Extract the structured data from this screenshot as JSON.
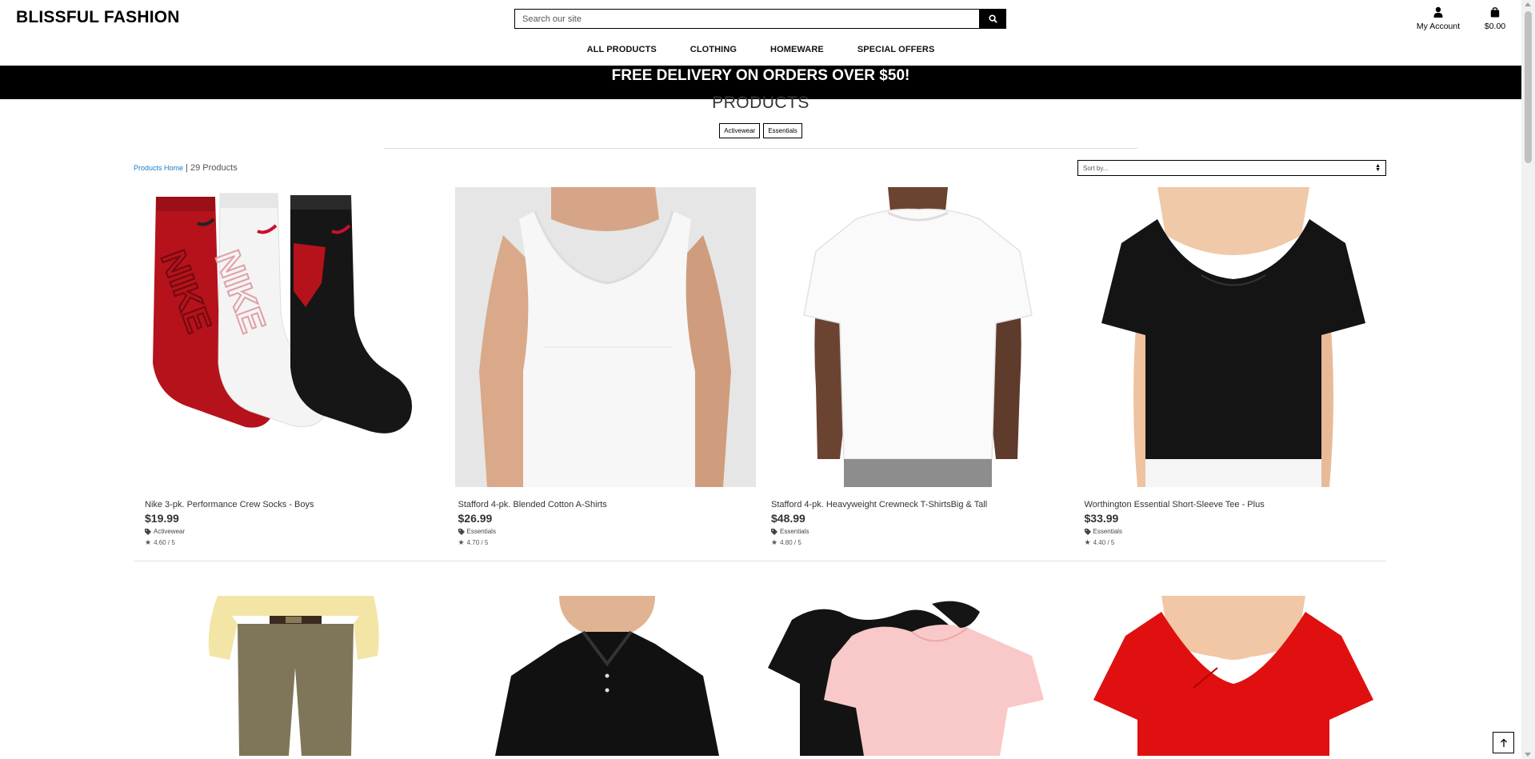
{
  "header": {
    "brand": "BLISSFUL FASHION",
    "search": {
      "placeholder": "Search our site",
      "value": ""
    },
    "account_label": "My Account",
    "cart_total": "$0.00"
  },
  "nav": {
    "items": [
      {
        "label": "ALL PRODUCTS"
      },
      {
        "label": "CLOTHING"
      },
      {
        "label": "HOMEWARE"
      },
      {
        "label": "SPECIAL OFFERS"
      }
    ]
  },
  "promo": {
    "text": "FREE DELIVERY ON ORDERS OVER $50!"
  },
  "page": {
    "title": "PRODUCTS",
    "filters": [
      {
        "label": "Activewear"
      },
      {
        "label": "Essentials"
      }
    ],
    "breadcrumb": {
      "link": "Products Home",
      "separator": " | ",
      "count": "29 Products"
    },
    "sort": {
      "selected": "Sort by..."
    }
  },
  "products": [
    {
      "name": "Nike 3-pk. Performance Crew Socks - Boys",
      "price": "$19.99",
      "category": "Activewear",
      "rating": "4.60 / 5"
    },
    {
      "name": "Stafford 4-pk. Blended Cotton A-Shirts",
      "price": "$26.99",
      "category": "Essentials",
      "rating": "4.70 / 5"
    },
    {
      "name": "Stafford 4-pk. Heavyweight Crewneck T-ShirtsBig & Tall",
      "price": "$48.99",
      "category": "Essentials",
      "rating": "4.80 / 5"
    },
    {
      "name": "Worthington Essential Short-Sleeve Tee - Plus",
      "price": "$33.99",
      "category": "Essentials",
      "rating": "4.40 / 5"
    }
  ],
  "colors": {
    "promo_bg": "#000000",
    "link": "#1a7bc7",
    "sock_red": "#b5121b"
  }
}
